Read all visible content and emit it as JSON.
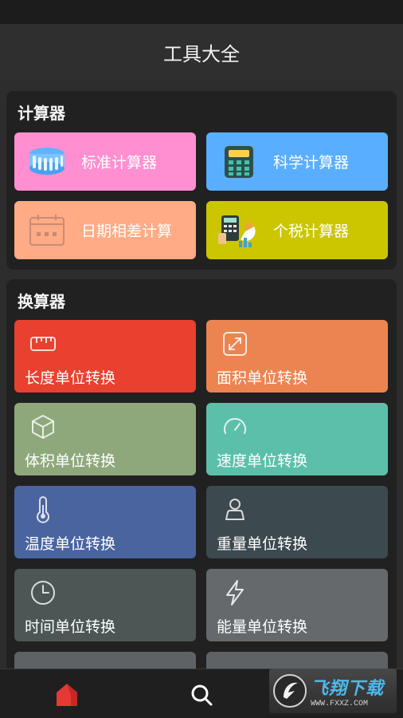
{
  "app": {
    "title": "工具大全"
  },
  "calculators": {
    "title": "计算器",
    "items": [
      {
        "label": "标准计算器",
        "icon": "abacus-icon",
        "color": "#ff8fd0"
      },
      {
        "label": "科学计算器",
        "icon": "calculator-icon",
        "color": "#5aaeff"
      },
      {
        "label": "日期相差计算",
        "icon": "calendar-icon",
        "color": "#ffab85"
      },
      {
        "label": "个税计算器",
        "icon": "tax-chart-icon",
        "color": "#cbc600"
      }
    ]
  },
  "converters": {
    "title": "换算器",
    "items": [
      {
        "label": "长度单位转换",
        "icon": "ruler-icon",
        "color": "#e8412f"
      },
      {
        "label": "面积单位转换",
        "icon": "resize-icon",
        "color": "#ec8451"
      },
      {
        "label": "体积单位转换",
        "icon": "cube-icon",
        "color": "#8ea87c"
      },
      {
        "label": "速度单位转换",
        "icon": "speedometer-icon",
        "color": "#5cbfaa"
      },
      {
        "label": "温度单位转换",
        "icon": "thermometer-icon",
        "color": "#4a64a0"
      },
      {
        "label": "重量单位转换",
        "icon": "weight-icon",
        "color": "#3c494f"
      },
      {
        "label": "时间单位转换",
        "icon": "clock-icon",
        "color": "#4b5655"
      },
      {
        "label": "能量单位转换",
        "icon": "lightning-icon",
        "color": "#65696b"
      }
    ]
  },
  "bottom_nav": [
    {
      "name": "home",
      "icon": "home-icon",
      "color": "#e53935"
    },
    {
      "name": "search",
      "icon": "search-icon",
      "color": "#ffffff"
    }
  ],
  "watermark": {
    "main": "飞翔下载",
    "sub": "WWW.FXXZ.COM"
  }
}
